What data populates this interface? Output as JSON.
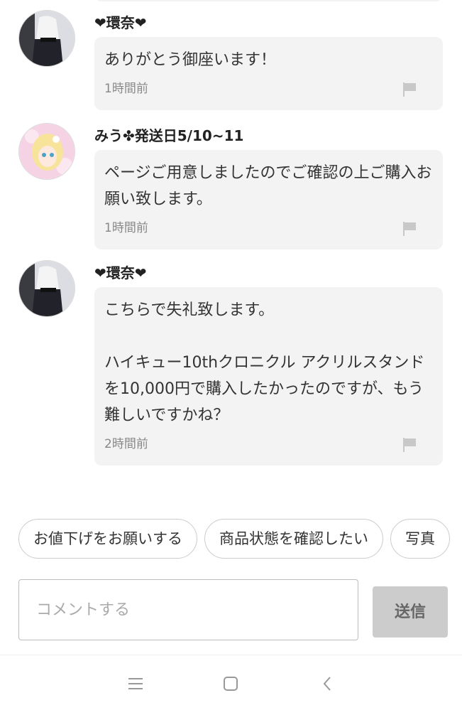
{
  "comments": [
    {
      "username": "❤環奈❤",
      "message": "ありがとう御座います！",
      "time": "1時間前",
      "avatar_icon": "avatar-photo-icon"
    },
    {
      "username": "みう✤発送日5/10~11",
      "message": "ページご用意しましたのでご確認の上ご購入お願い致します。",
      "time": "1時間前",
      "avatar_icon": "avatar-illustration-icon"
    },
    {
      "username": "❤環奈❤",
      "message": "こちらで失礼致します。\n\nハイキュー10thクロニクル アクリルスタンド　を10,000円で購入したかったのですが、もう難しいですかね？",
      "time": "2時間前",
      "avatar_icon": "avatar-photo-icon"
    }
  ],
  "quick_replies": [
    "お値下げをお願いする",
    "商品状態を確認したい",
    "写真"
  ],
  "comment_box": {
    "placeholder": "コメントする",
    "value": "",
    "send_label": "送信"
  },
  "nav_icons": [
    "menu-icon",
    "home-square-icon",
    "back-chevron-icon"
  ],
  "colors": {
    "bubble": "#f3f3f3",
    "send_button": "#cccccc",
    "flag": "#c8c8c8"
  }
}
